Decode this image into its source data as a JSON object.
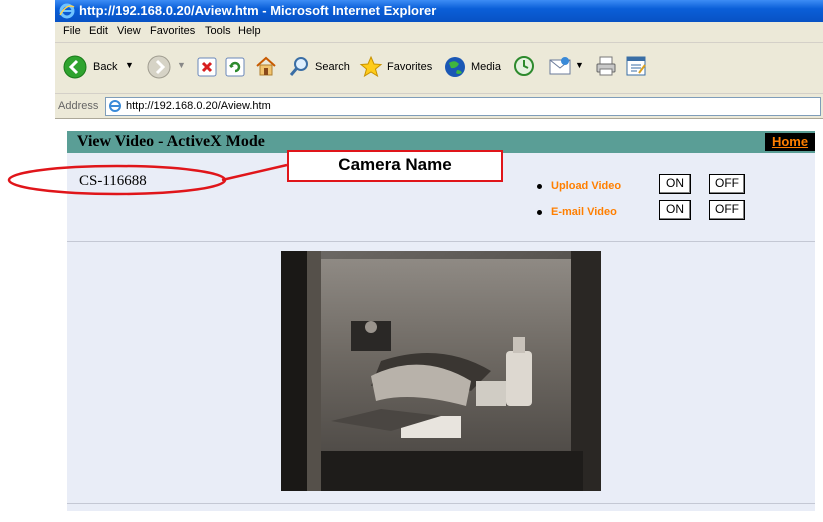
{
  "window": {
    "title": "http://192.168.0.20/Aview.htm - Microsoft Internet Explorer"
  },
  "menu": [
    "File",
    "Edit",
    "View",
    "Favorites",
    "Tools",
    "Help"
  ],
  "toolbar": {
    "back_label": "Back",
    "search_label": "Search",
    "favorites_label": "Favorites",
    "media_label": "Media"
  },
  "address": {
    "label": "Address",
    "url": "http://192.168.0.20/Aview.htm"
  },
  "page": {
    "title": "View Video - ActiveX Mode",
    "home_link": "Home",
    "camera_name": "CS-116688",
    "options": [
      {
        "label": "Upload Video",
        "on": "ON",
        "off": "OFF"
      },
      {
        "label": "E-mail Video",
        "on": "ON",
        "off": "OFF"
      }
    ]
  },
  "annotation": {
    "callout_text": "Camera Name",
    "color": "#e0151a"
  },
  "colors": {
    "header_bar": "#5a9e96",
    "panel_bg": "#e9edf7",
    "link_orange": "#ff7f00",
    "titlebar_blue": "#0a5fd8"
  }
}
